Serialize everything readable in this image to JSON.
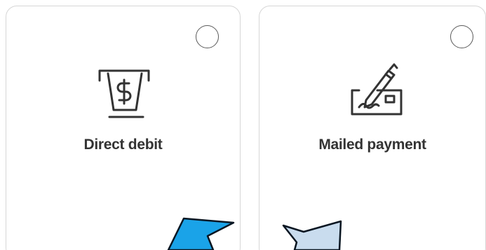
{
  "payment_options": [
    {
      "label": "Direct debit",
      "icon": "atm-cash-dispense-icon",
      "selected": false
    },
    {
      "label": "Mailed payment",
      "icon": "signed-check-icon",
      "selected": false
    }
  ],
  "colors": {
    "border": "#d6d6d6",
    "text": "#333333",
    "icon": "#333333",
    "arrow_left": "#1aa3e8",
    "arrow_right": "#c9dcee"
  }
}
